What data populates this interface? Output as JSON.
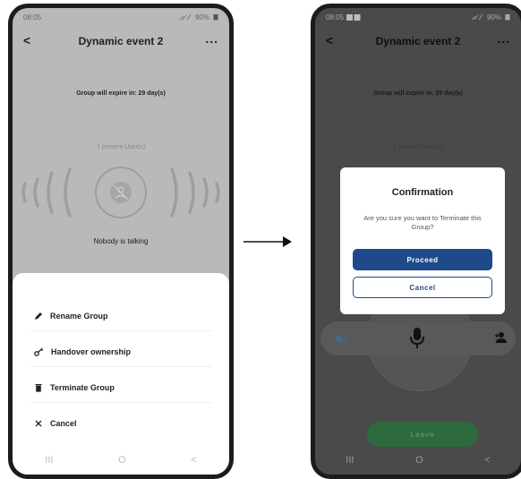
{
  "left_phone": {
    "status": {
      "time": "08:05",
      "battery": "90%"
    },
    "appbar": {
      "back": "<",
      "title": "Dynamic event 2",
      "more": "..."
    },
    "expire_text": "Group will expire in: 29 day(s)",
    "present_text": "1 present User(s)",
    "talking_text": "Nobody is talking",
    "menu": {
      "items": [
        {
          "label": "Rename Group",
          "icon": "pencil-icon"
        },
        {
          "label": "Handover ownership",
          "icon": "key-icon"
        },
        {
          "label": "Terminate Group",
          "icon": "trash-icon"
        },
        {
          "label": "Cancel",
          "icon": "close-icon"
        }
      ]
    },
    "navbar": {
      "recents": "III",
      "home": "O",
      "back": "<"
    }
  },
  "right_phone": {
    "status": {
      "time": "08:05",
      "battery": "90%"
    },
    "appbar": {
      "back": "<",
      "title": "Dynamic event 2",
      "more": "..."
    },
    "expire_text": "Group will expire in: 29 day(s)",
    "present_text": "1 present User(s)",
    "dialog": {
      "title": "Confirmation",
      "message": "Are you sure you want to Terminate this Group?",
      "proceed_label": "Proceed",
      "cancel_label": "Cancel"
    },
    "leave_label": "Leave",
    "navbar": {
      "recents": "III",
      "home": "O",
      "back": "<"
    }
  },
  "colors": {
    "primary": "#1e4a8a",
    "leave": "#2d6a3d",
    "scrim_left": "#b9b9b9",
    "scrim_right": "#4a4a4a"
  }
}
